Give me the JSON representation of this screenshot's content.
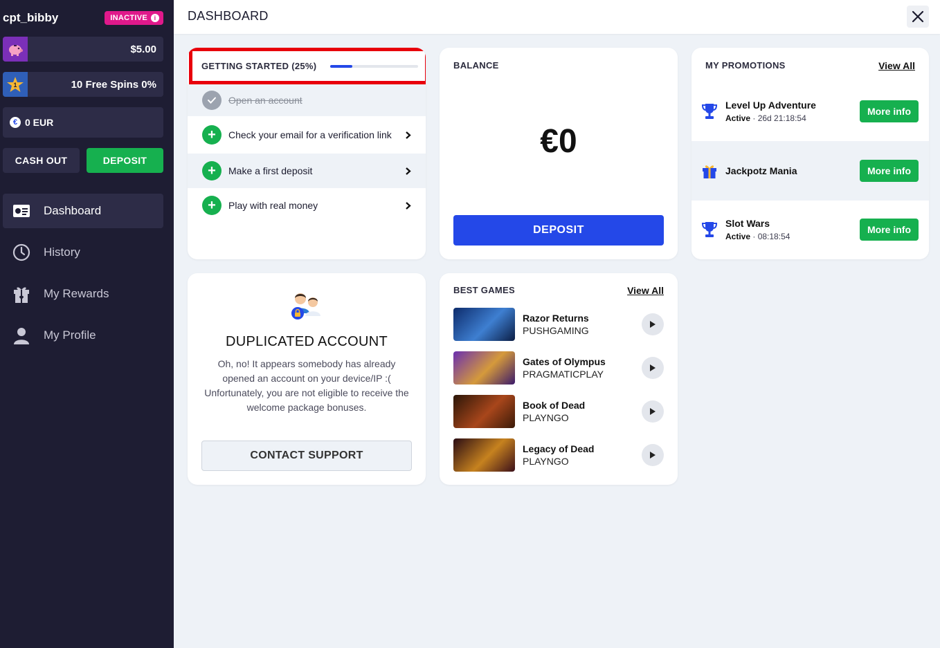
{
  "sidebar": {
    "username": "cpt_bibby",
    "status_badge": "INACTIVE",
    "wallets": [
      {
        "icon": "piggy-bank-icon",
        "value": "$5.00"
      },
      {
        "icon": "level-star-icon",
        "level": "1",
        "value": "10 Free Spins 0%"
      }
    ],
    "eur": {
      "icon": "euro-coin-icon",
      "value": "0 EUR"
    },
    "cashout_label": "CASH OUT",
    "deposit_label": "DEPOSIT",
    "nav": [
      {
        "label": "Dashboard",
        "icon": "dashboard-icon",
        "active": true
      },
      {
        "label": "History",
        "icon": "history-icon",
        "active": false
      },
      {
        "label": "My Rewards",
        "icon": "gift-icon",
        "active": false
      },
      {
        "label": "My Profile",
        "icon": "profile-icon",
        "active": false
      }
    ]
  },
  "header": {
    "title": "DASHBOARD"
  },
  "getting_started": {
    "title": "GETTING STARTED (25%)",
    "progress": 0.25,
    "steps": [
      {
        "label": "Open an account",
        "done": true
      },
      {
        "label": "Check your email for a verification link",
        "done": false
      },
      {
        "label": "Make a first deposit",
        "done": false
      },
      {
        "label": "Play with real money",
        "done": false
      }
    ]
  },
  "balance": {
    "title": "BALANCE",
    "amount": "€0",
    "deposit_label": "DEPOSIT"
  },
  "promotions": {
    "title": "MY PROMOTIONS",
    "view_all": "View All",
    "items": [
      {
        "name": "Level Up Adventure",
        "status": "Active",
        "timer": "26d 21:18:54",
        "icon": "trophy-icon",
        "button": "More info"
      },
      {
        "name": "Jackpotz Mania",
        "status": "",
        "timer": "",
        "icon": "gift-box-icon",
        "button": "More info"
      },
      {
        "name": "Slot Wars",
        "status": "Active",
        "timer": "08:18:54",
        "icon": "trophy-icon",
        "button": "More info"
      }
    ]
  },
  "duplicated": {
    "title": "DUPLICATED ACCOUNT",
    "message": "Oh, no! It appears somebody has already opened an account on your device/IP :( Unfortunately, you are not eligible to receive the welcome package bonuses.",
    "button": "CONTACT SUPPORT"
  },
  "best_games": {
    "title": "BEST GAMES",
    "view_all": "View All",
    "games": [
      {
        "name": "Razor Returns",
        "provider": "PUSHGAMING"
      },
      {
        "name": "Gates of Olympus",
        "provider": "PRAGMATICPLAY"
      },
      {
        "name": "Book of Dead",
        "provider": "PLAYNGO"
      },
      {
        "name": "Legacy of Dead",
        "provider": "PLAYNGO"
      }
    ]
  },
  "colors": {
    "sidebar_bg": "#1e1d33",
    "accent_blue": "#2448e8",
    "accent_green": "#16b04f",
    "badge_pink": "#e0198b",
    "highlight_red": "#e8000b"
  }
}
